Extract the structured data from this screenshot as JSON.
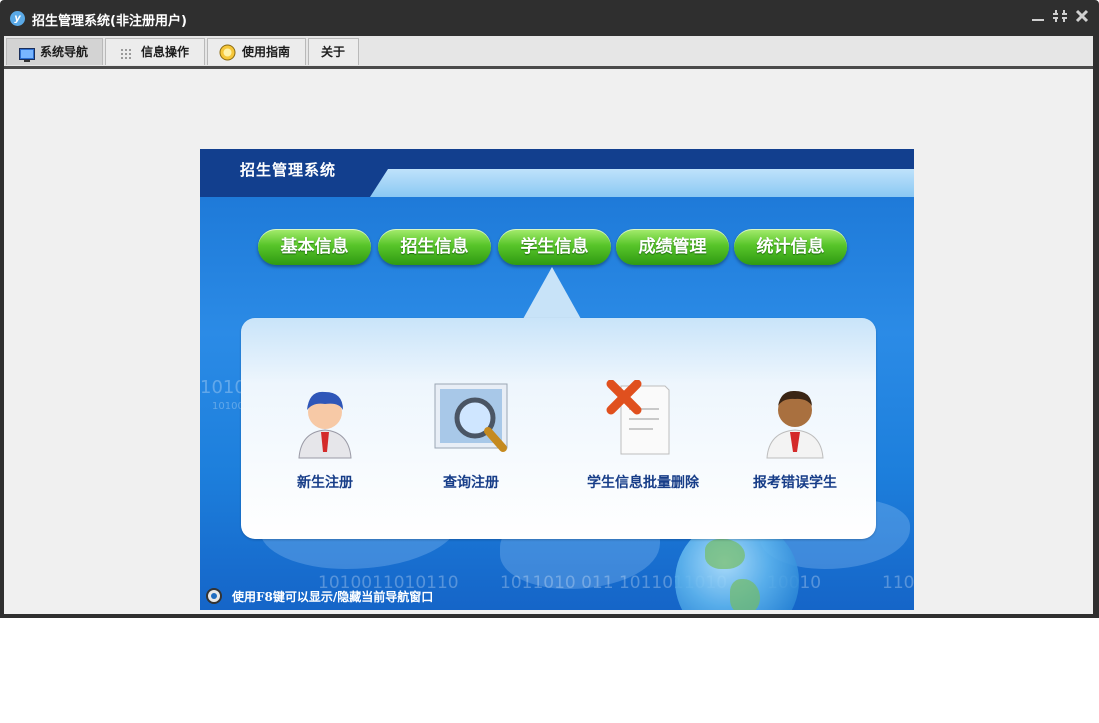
{
  "window": {
    "title": "招生管理系统(非注册用户)",
    "logo_glyph": "y",
    "controls": [
      "minimize-icon",
      "restore-icon",
      "close-icon"
    ]
  },
  "menu": {
    "tabs": [
      {
        "label": "系统导航",
        "icon": "monitor-icon",
        "active": true
      },
      {
        "label": "信息操作",
        "icon": "grid-icon",
        "active": false
      },
      {
        "label": "使用指南",
        "icon": "help-icon",
        "active": false
      },
      {
        "label": "关于",
        "icon": "",
        "active": false
      }
    ]
  },
  "panel": {
    "title": "招生管理系统",
    "nav_buttons": [
      "基本信息",
      "招生信息",
      "学生信息",
      "成绩管理",
      "统计信息"
    ],
    "selected_nav": "学生信息",
    "functions": [
      {
        "label": "新生注册",
        "icon": "new-student-icon"
      },
      {
        "label": "查询注册",
        "icon": "search-magnifier-icon"
      },
      {
        "label": "学生信息批量删除",
        "icon": "delete-document-icon"
      },
      {
        "label": "报考错误学生",
        "icon": "error-student-icon"
      }
    ],
    "binary_decor": [
      "1010",
      "10100",
      "1010011010110",
      "1011010 011 1011011010",
      "10010",
      "110"
    ],
    "hint": "使用F8键可以显示/隐藏当前导航窗口"
  },
  "colors": {
    "titlebar": "#2f2f2f",
    "panel_blue": "#1a74d4",
    "header_dark": "#123f8e",
    "pill_green": "#58c52a",
    "label_blue": "#173d88"
  }
}
